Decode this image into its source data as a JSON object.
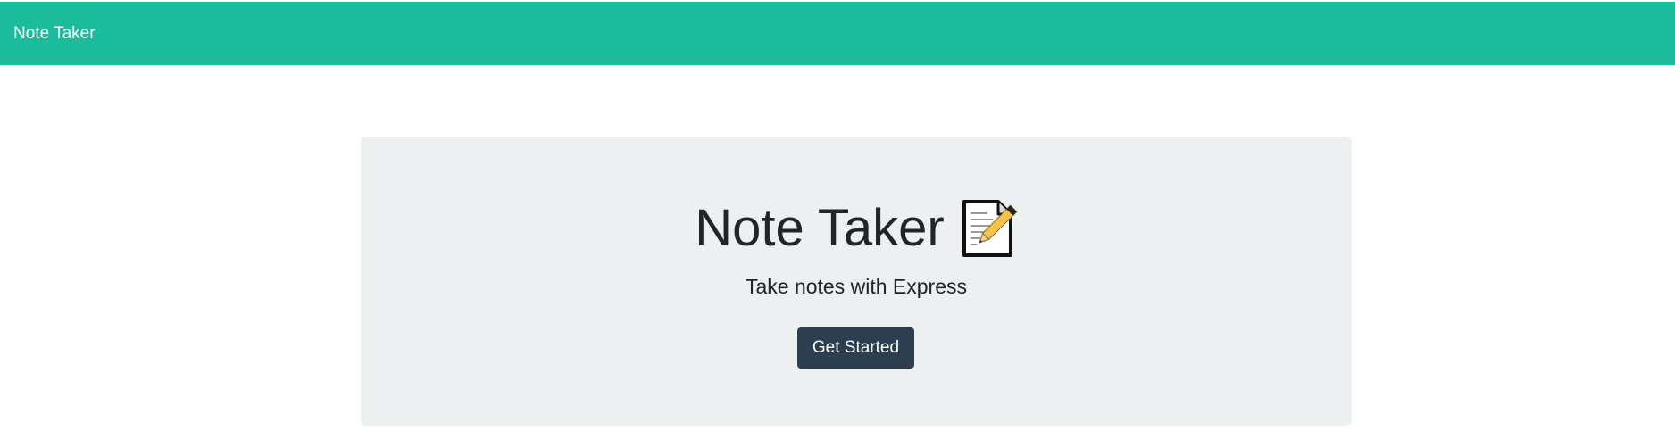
{
  "navbar": {
    "brand": "Note Taker",
    "background": "#1abc9c"
  },
  "hero": {
    "title": "Note Taker",
    "title_icon": "memo-icon",
    "subtitle": "Take notes with Express",
    "button_label": "Get Started",
    "background": "#ecf0f1",
    "button_color": "#2c3e50"
  }
}
